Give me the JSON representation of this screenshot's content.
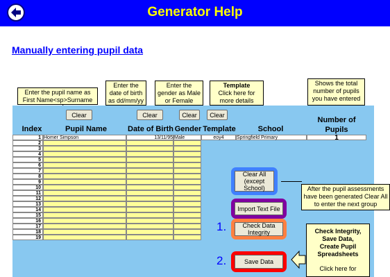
{
  "header": {
    "title": "Generator Help"
  },
  "subtitle": "Manually entering pupil data",
  "tooltips": {
    "name": "Enter the pupil name as First Name<sp>Surname",
    "dob": "Enter the date of birth as dd/mm/yy",
    "gender": "Enter the gender as Male or Female",
    "template_title": "Template",
    "template_body": "Click here for more details",
    "total": "Shows the total number of pupils you have entered",
    "clear_all": "After the pupil assessments have been generated Clear All to enter the next group",
    "check": [
      "Check Integrity,",
      "Save Data,",
      "Create Pupil",
      "Spreadsheets"
    ],
    "check_more": "Click here for"
  },
  "sheet": {
    "clear_label": "Clear",
    "columns": {
      "index": "Index",
      "name": "Pupil Name",
      "dob": "Date of Birth",
      "gender": "Gender",
      "template": "Template",
      "school": "School",
      "number": "Number of Pupils"
    },
    "pupil_count": "1",
    "row1": {
      "name": "Homer Simpson",
      "dob": "13/11/95",
      "gender": "Male",
      "template": "eoy4",
      "school": "Springfield Primary"
    },
    "indices": [
      "1",
      "2",
      "3",
      "4",
      "5",
      "6",
      "7",
      "8",
      "9",
      "10",
      "11",
      "12",
      "13",
      "14",
      "15",
      "16",
      "17",
      "18",
      "19"
    ]
  },
  "actions": {
    "clear_all": "Clear All (except School)",
    "import": "Import Text File",
    "check": "Check Data Integrity",
    "save": "Save Data",
    "step1": "1.",
    "step2": "2."
  },
  "colors": {
    "header_bg": "#0000ff",
    "title": "#ffff00",
    "sheet_bg": "#88c8f0",
    "input_cell": "#ffff99"
  }
}
